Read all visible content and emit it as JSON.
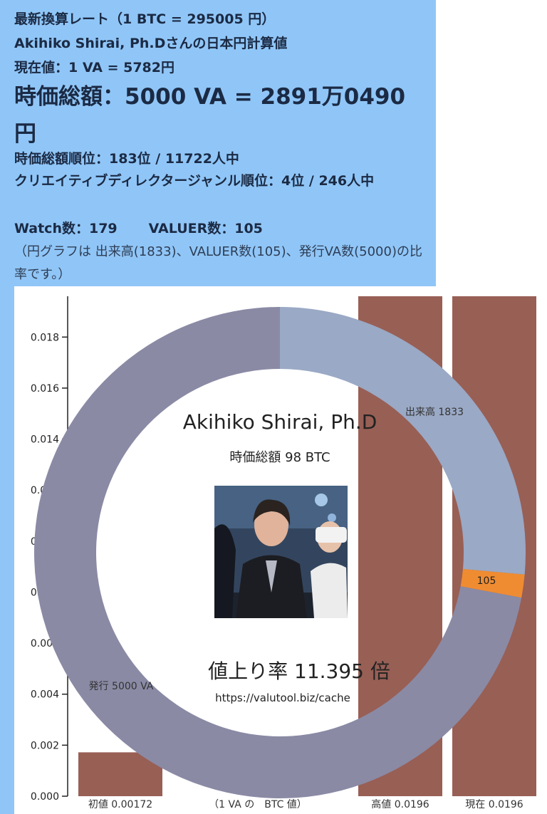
{
  "info": {
    "rate_line": "最新換算レート（1 BTC = 295005 円）",
    "calc_line": "Akihiko Shirai, Ph.Dさんの日本円計算値",
    "price_line": "現在値：1 VA = 5782円",
    "mcap_line": "時価総額：5000 VA = 2891万0490円",
    "rank_line": "時価総額順位：183位 / 11722人中",
    "genre_line": "クリエイティブディレクタージャンル順位：4位 / 246人中",
    "watch": "Watch数：179",
    "valuer": "VALUER数：105",
    "note": "（円グラフは 出来高(1833)、VALUER数(105)、発行VA数(5000)の比率です。）"
  },
  "overlay": {
    "name": "Akihiko Shirai, Ph.D",
    "market_cap": "時価総額 98 BTC",
    "rise_rate": "値上り率 11.395 倍",
    "url": "https://valutool.biz/cache"
  },
  "colors": {
    "panel": "#90c6f7",
    "bar": "#985f55",
    "donut_volume": "#9aa9c5",
    "donut_valuer": "#ef8c32",
    "donut_issued": "#8a8aa5"
  },
  "chart_data": [
    {
      "type": "bar",
      "categories": [
        "初値 0.00172",
        "高値 0.0196",
        "現在 0.0196"
      ],
      "values": [
        0.00172,
        0.0196,
        0.0196
      ],
      "xlabel": "（1 VA の　BTC 値）",
      "ylim": [
        0,
        0.0196
      ],
      "yticks": [
        "0.000",
        "0.002",
        "0.004",
        "0.006",
        "0.008",
        "0.010",
        "0.012",
        "0.014",
        "0.016",
        "0.018"
      ]
    },
    {
      "type": "pie",
      "labels": [
        "出来高 1833",
        "105",
        "発行 5000 VA"
      ],
      "values": [
        1833,
        105,
        5000
      ]
    }
  ]
}
